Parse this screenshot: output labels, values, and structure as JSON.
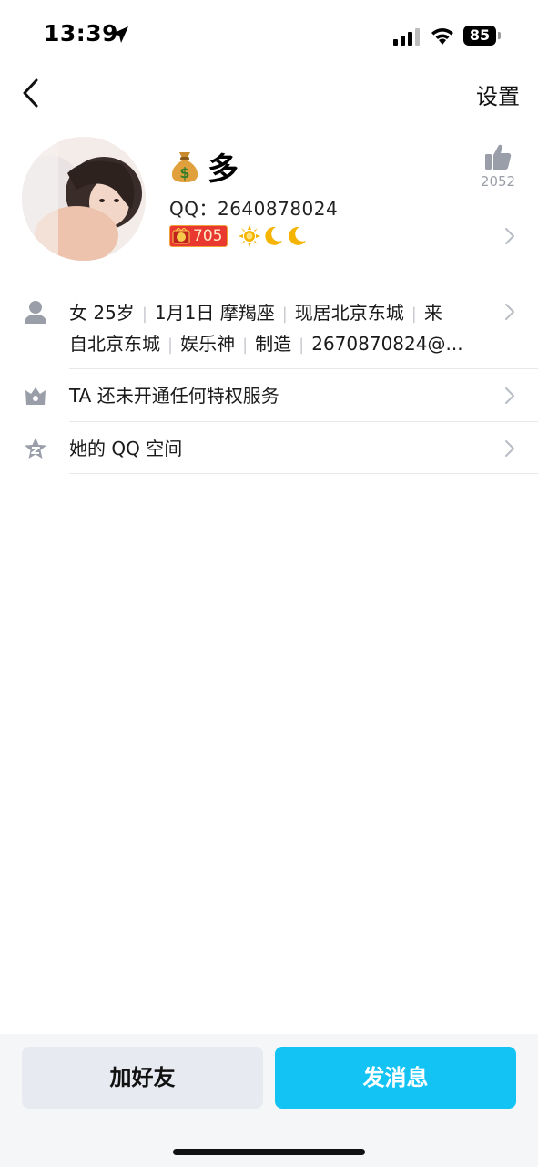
{
  "status_bar": {
    "time": "13:39",
    "battery": "85"
  },
  "nav": {
    "settings_label": "设置"
  },
  "profile": {
    "nickname": "多",
    "qq_label": "QQ：2640878024",
    "level": "705",
    "likes": "2052"
  },
  "info": {
    "line1_parts": [
      "女 25岁",
      "1月1日 摩羯座",
      "现居北京东城",
      "来"
    ],
    "line2_parts": [
      "自北京东城",
      "娱乐神",
      "制造",
      "2670870824@..."
    ]
  },
  "rows": {
    "privilege": "TA 还未开通任何特权服务",
    "qzone": "她的 QQ 空间"
  },
  "actions": {
    "add_friend": "加好友",
    "send_message": "发消息"
  },
  "colors": {
    "primary": "#12c3f4",
    "secondary_button": "#e7eaf1",
    "icon_gray": "#9a9ea8",
    "level_badge": "#e8382f"
  }
}
